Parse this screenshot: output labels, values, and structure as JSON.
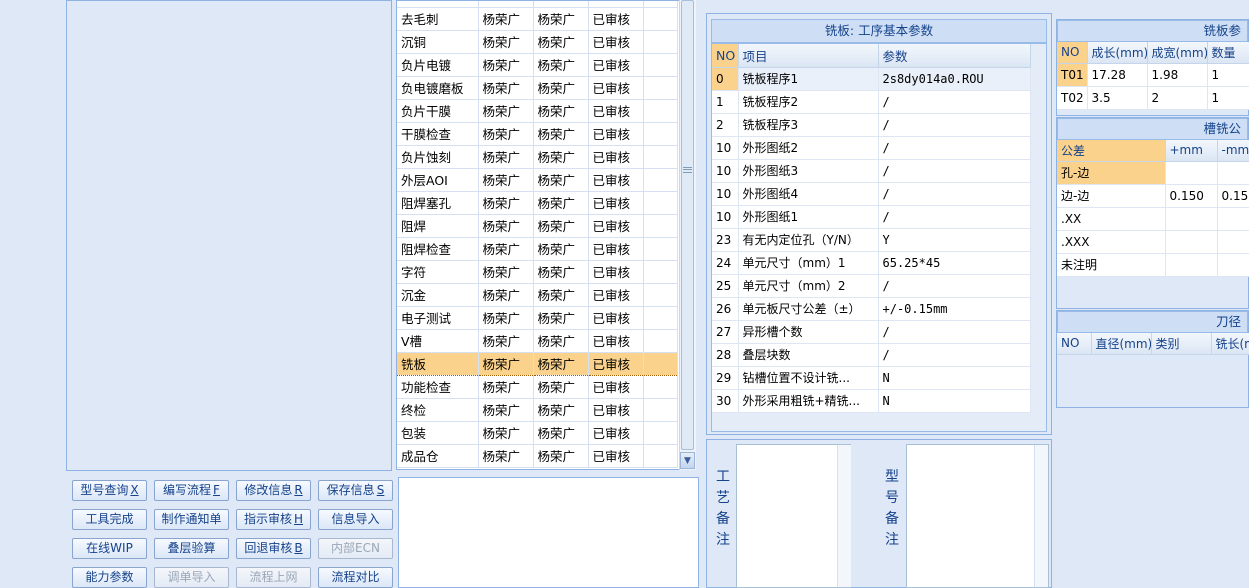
{
  "route_table": {
    "rows": [
      {
        "proc": "",
        "a": "",
        "b": "",
        "status": ""
      },
      {
        "proc": "去毛刺",
        "a": "杨荣广",
        "b": "杨荣广",
        "status": "已审核"
      },
      {
        "proc": "沉铜",
        "a": "杨荣广",
        "b": "杨荣广",
        "status": "已审核"
      },
      {
        "proc": "负片电镀",
        "a": "杨荣广",
        "b": "杨荣广",
        "status": "已审核"
      },
      {
        "proc": "负电镀磨板",
        "a": "杨荣广",
        "b": "杨荣广",
        "status": "已审核"
      },
      {
        "proc": "负片干膜",
        "a": "杨荣广",
        "b": "杨荣广",
        "status": "已审核"
      },
      {
        "proc": "干膜检查",
        "a": "杨荣广",
        "b": "杨荣广",
        "status": "已审核"
      },
      {
        "proc": "负片蚀刻",
        "a": "杨荣广",
        "b": "杨荣广",
        "status": "已审核"
      },
      {
        "proc": "外层AOI",
        "a": "杨荣广",
        "b": "杨荣广",
        "status": "已审核"
      },
      {
        "proc": "阻焊塞孔",
        "a": "杨荣广",
        "b": "杨荣广",
        "status": "已审核"
      },
      {
        "proc": "阻焊",
        "a": "杨荣广",
        "b": "杨荣广",
        "status": "已审核"
      },
      {
        "proc": "阻焊检查",
        "a": "杨荣广",
        "b": "杨荣广",
        "status": "已审核"
      },
      {
        "proc": "字符",
        "a": "杨荣广",
        "b": "杨荣广",
        "status": "已审核"
      },
      {
        "proc": "沉金",
        "a": "杨荣广",
        "b": "杨荣广",
        "status": "已审核"
      },
      {
        "proc": "电子测试",
        "a": "杨荣广",
        "b": "杨荣广",
        "status": "已审核"
      },
      {
        "proc": "V槽",
        "a": "杨荣广",
        "b": "杨荣广",
        "status": "已审核"
      },
      {
        "proc": "铣板",
        "a": "杨荣广",
        "b": "杨荣广",
        "status": "已审核"
      },
      {
        "proc": "功能检查",
        "a": "杨荣广",
        "b": "杨荣广",
        "status": "已审核"
      },
      {
        "proc": "终检",
        "a": "杨荣广",
        "b": "杨荣广",
        "status": "已审核"
      },
      {
        "proc": "包装",
        "a": "杨荣广",
        "b": "杨荣广",
        "status": "已审核"
      },
      {
        "proc": "成品仓",
        "a": "杨荣广",
        "b": "杨荣广",
        "status": "已审核"
      }
    ]
  },
  "buttons": [
    {
      "label": "型号查询",
      "key": "X",
      "enabled": true
    },
    {
      "label": "编写流程",
      "key": "F",
      "enabled": true
    },
    {
      "label": "修改信息",
      "key": "R",
      "enabled": true
    },
    {
      "label": "保存信息",
      "key": "S",
      "enabled": true
    },
    {
      "label": "工具完成",
      "key": "",
      "enabled": true
    },
    {
      "label": "制作通知单",
      "key": "",
      "enabled": true
    },
    {
      "label": "指示审核",
      "key": "H",
      "enabled": true
    },
    {
      "label": "信息导入",
      "key": "",
      "enabled": true
    },
    {
      "label": "在线WIP",
      "key": "",
      "enabled": true
    },
    {
      "label": "叠层验算",
      "key": "",
      "enabled": true
    },
    {
      "label": "回退审核",
      "key": "B",
      "enabled": true
    },
    {
      "label": "内部ECN",
      "key": "",
      "enabled": false
    },
    {
      "label": "能力参数",
      "key": "",
      "enabled": true
    },
    {
      "label": "调单导入",
      "key": "",
      "enabled": false
    },
    {
      "label": "流程上网",
      "key": "",
      "enabled": false
    },
    {
      "label": "流程对比",
      "key": "",
      "enabled": true
    }
  ],
  "params": {
    "title": "铣板: 工序基本参数",
    "headers": {
      "no": "NO",
      "item": "项目",
      "value": "参数"
    },
    "rows": [
      {
        "no": "0",
        "item": "铣板程序1",
        "value": "2s8dy014a0.ROU"
      },
      {
        "no": "1",
        "item": "铣板程序2",
        "value": "/"
      },
      {
        "no": "2",
        "item": "铣板程序3",
        "value": "/"
      },
      {
        "no": "10",
        "item": "外形图纸2",
        "value": "/"
      },
      {
        "no": "10",
        "item": "外形图纸3",
        "value": "/"
      },
      {
        "no": "10",
        "item": "外形图纸4",
        "value": "/"
      },
      {
        "no": "10",
        "item": "外形图纸1",
        "value": "/"
      },
      {
        "no": "23",
        "item": "有无内定位孔（Y/N）",
        "value": "Y"
      },
      {
        "no": "24",
        "item": "单元尺寸（mm）1",
        "value": "65.25*45"
      },
      {
        "no": "25",
        "item": "单元尺寸（mm）2",
        "value": "/"
      },
      {
        "no": "26",
        "item": "单元板尺寸公差（±）",
        "value": "+/-0.15mm"
      },
      {
        "no": "27",
        "item": "异形槽个数",
        "value": "/"
      },
      {
        "no": "28",
        "item": "叠层块数",
        "value": "/"
      },
      {
        "no": "29",
        "item": "钻槽位置不设计铣...",
        "value": "N"
      },
      {
        "no": "30",
        "item": "外形采用粗铣+精铣...",
        "value": "N"
      }
    ]
  },
  "remarks": {
    "process_label": "工艺备注",
    "model_label": "型号备注"
  },
  "right": {
    "board_title": "铣板参",
    "board_headers": [
      "NO",
      "成长(mm)",
      "成宽(mm)",
      "数量"
    ],
    "board_rows": [
      [
        "T01",
        "17.28",
        "1.98",
        "1"
      ],
      [
        "T02",
        "3.5",
        "2",
        "1"
      ]
    ],
    "slot_title": "槽铣公",
    "tol_headers": [
      "公差",
      "+mm",
      "-mm"
    ],
    "tol_rows": [
      [
        "孔-边",
        "",
        ""
      ],
      [
        "边-边",
        "0.150",
        "0.15"
      ],
      [
        ".XX",
        "",
        ""
      ],
      [
        ".XXX",
        "",
        ""
      ],
      [
        "未注明",
        "",
        ""
      ]
    ],
    "tool_title": "刀径",
    "tool_headers": [
      "NO",
      "直径(mm)",
      "类别",
      "铣长(m"
    ]
  },
  "colors": {
    "panel_bg": "#dfe8f6",
    "border": "#8db2e3",
    "selection": "#fbd28c",
    "text_accent": "#15428b"
  }
}
